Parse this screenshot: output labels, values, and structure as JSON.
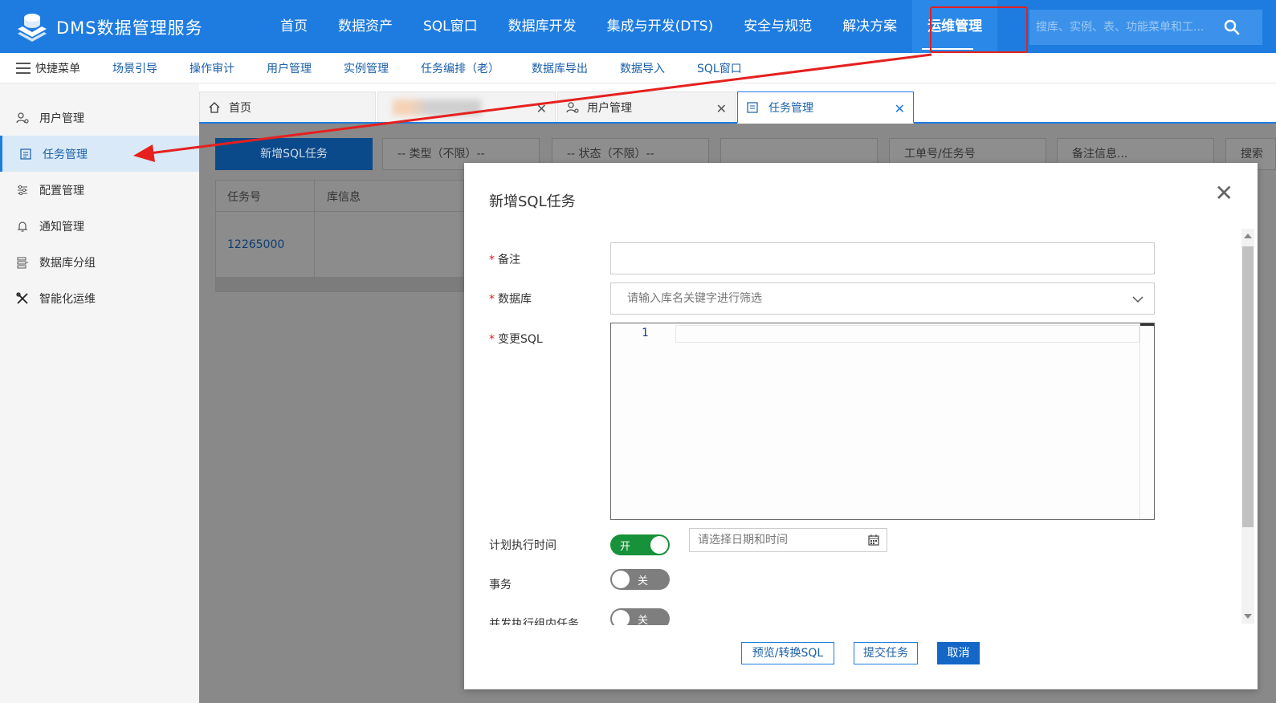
{
  "app": {
    "title": "DMS数据管理服务"
  },
  "topnav": {
    "items": [
      "首页",
      "数据资产",
      "SQL窗口",
      "数据库开发",
      "集成与开发(DTS)",
      "安全与规范",
      "解决方案",
      "运维管理"
    ],
    "active": "运维管理",
    "search_placeholder": "搜库、实例、表、功能菜单和工..."
  },
  "quickbar": {
    "menu_label": "快捷菜单",
    "links": [
      "场景引导",
      "操作审计",
      "用户管理",
      "实例管理",
      "任务编排（老）",
      "数据库导出",
      "数据导入",
      "SQL窗口"
    ]
  },
  "sidebar": {
    "items": [
      {
        "label": "用户管理",
        "icon": "user-icon"
      },
      {
        "label": "任务管理",
        "icon": "task-list-icon",
        "active": true
      },
      {
        "label": "配置管理",
        "icon": "sliders-icon"
      },
      {
        "label": "通知管理",
        "icon": "bell-icon"
      },
      {
        "label": "数据库分组",
        "icon": "database-group-icon"
      },
      {
        "label": "智能化运维",
        "icon": "tools-icon"
      }
    ]
  },
  "tabs": [
    {
      "label": "首页",
      "icon": "home-icon"
    },
    {
      "label": "",
      "blurred": true
    },
    {
      "label": "用户管理",
      "icon": "user-icon"
    },
    {
      "label": "任务管理",
      "icon": "task-list-icon",
      "active": true
    }
  ],
  "page": {
    "add_button": "新增SQL任务",
    "filters": {
      "type": "-- 类型（不限）--",
      "status": "-- 状态（不限）--",
      "order_placeholder": "工单号/任务号",
      "remark_placeholder": "备注信息...",
      "search": "搜索"
    },
    "table": {
      "headers": [
        "任务号",
        "库信息"
      ],
      "rows": [
        {
          "task_id": "12265000"
        }
      ]
    }
  },
  "modal": {
    "title": "新增SQL任务",
    "fields": {
      "remark_label": "备注",
      "remark_value": "",
      "database_label": "数据库",
      "database_placeholder": "请输入库名关键字进行筛选",
      "sql_label": "变更SQL",
      "sql_line_number": "1",
      "schedule_label": "计划执行时间",
      "schedule_toggle": "开",
      "schedule_placeholder": "请选择日期和时间",
      "transaction_label": "事务",
      "transaction_toggle": "关",
      "concurrent_label": "并发执行组内任务",
      "concurrent_toggle": "关"
    },
    "buttons": {
      "preview": "预览/转换SQL",
      "submit": "提交任务",
      "cancel": "取消"
    }
  },
  "colors": {
    "brand": "#1e7ce0",
    "highlight": "#e5201f",
    "toggle_on": "#17923a"
  }
}
